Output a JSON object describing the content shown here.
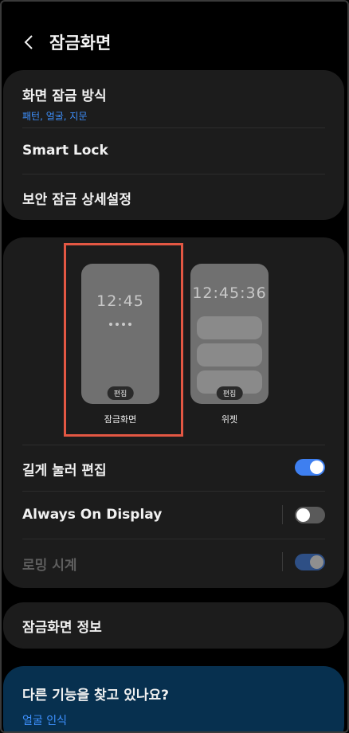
{
  "header": {
    "title": "잠금화면"
  },
  "security": {
    "screen_lock_type": {
      "label": "화면 잠금 방식",
      "value": "패턴, 얼굴, 지문"
    },
    "smart_lock": {
      "label": "Smart Lock"
    },
    "secure_lock_settings": {
      "label": "보안 잠금 상세설정"
    }
  },
  "previews": {
    "lockscreen": {
      "time": "12:45",
      "edit_label": "편집",
      "caption": "잠금화면"
    },
    "widgets": {
      "time": "12:45:36",
      "edit_label": "편집",
      "caption": "위젯"
    }
  },
  "toggles": {
    "long_press_edit": {
      "label": "길게 눌러 편집",
      "state": "on"
    },
    "always_on_display": {
      "label": "Always On Display",
      "state": "off"
    },
    "roaming_clock": {
      "label": "로밍 시계",
      "state": "on-disabled"
    }
  },
  "lockscreen_info": {
    "label": "잠금화면 정보"
  },
  "suggestion": {
    "title": "다른 기능을 찾고 있나요?",
    "link": "얼굴 인식"
  },
  "colors": {
    "accent": "#3e7ff0",
    "link": "#3e91ff",
    "highlight": "#e35743",
    "card": "#1c1c1c",
    "promo": "#07304f"
  }
}
